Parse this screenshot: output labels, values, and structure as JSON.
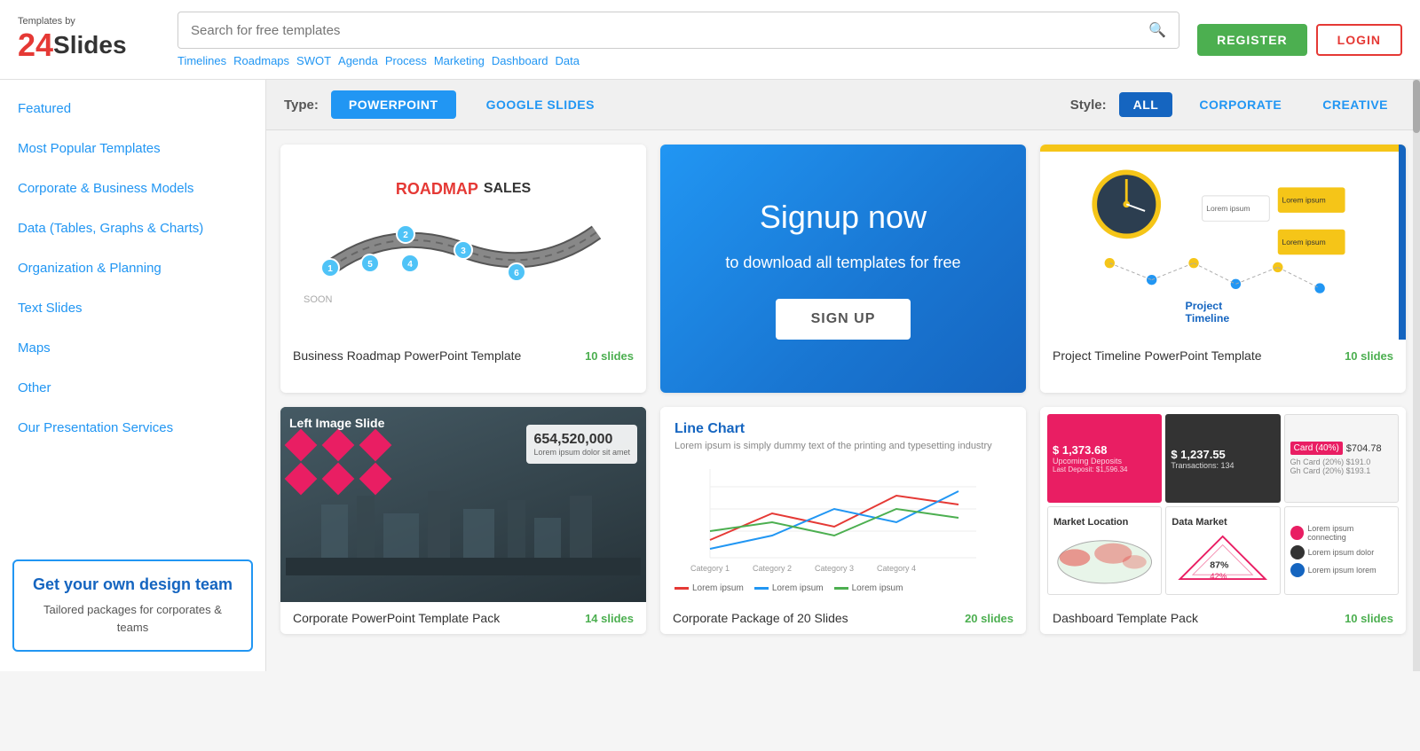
{
  "header": {
    "logo_prefix": "Templates by",
    "logo_brand": "Slides",
    "logo_number": "24",
    "search_placeholder": "Search for free templates",
    "search_tags": [
      "Timelines",
      "Roadmaps",
      "SWOT",
      "Agenda",
      "Process",
      "Marketing",
      "Dashboard",
      "Data"
    ],
    "register_label": "REGISTER",
    "login_label": "LOGIN"
  },
  "filter": {
    "type_label": "Type:",
    "type_options": [
      {
        "label": "POWERPOINT",
        "active": true
      },
      {
        "label": "GOOGLE SLIDES",
        "active": false
      }
    ],
    "style_label": "Style:",
    "style_options": [
      {
        "label": "ALL",
        "active": true
      },
      {
        "label": "CORPORATE",
        "active": false
      },
      {
        "label": "CREATIVE",
        "active": false
      }
    ]
  },
  "sidebar": {
    "nav_items": [
      {
        "label": "Featured",
        "active": false
      },
      {
        "label": "Most Popular Templates",
        "active": false
      },
      {
        "label": "Corporate & Business Models",
        "active": false
      },
      {
        "label": "Data (Tables, Graphs & Charts)",
        "active": false
      },
      {
        "label": "Organization & Planning",
        "active": false
      },
      {
        "label": "Text Slides",
        "active": false
      },
      {
        "label": "Maps",
        "active": false
      },
      {
        "label": "Other",
        "active": false
      },
      {
        "label": "Our Presentation Services",
        "active": false
      }
    ],
    "promo_title": "Get your own design team",
    "promo_desc": "Tailored packages for corporates & teams"
  },
  "cards": [
    {
      "id": "roadmap",
      "title": "Business Roadmap PowerPoint Template",
      "slides": "10 slides",
      "type": "roadmap"
    },
    {
      "id": "signup",
      "type": "signup",
      "title": "Signup now",
      "subtitle": "to download all templates for free",
      "btn_label": "SIGN UP"
    },
    {
      "id": "timeline",
      "title": "Project Timeline PowerPoint Template",
      "slides": "10 slides",
      "type": "timeline"
    },
    {
      "id": "corporate",
      "title": "Corporate PowerPoint Template Pack",
      "slides": "14 slides",
      "type": "corporate"
    },
    {
      "id": "linechart",
      "title": "Corporate Package of 20 Slides",
      "slides": "20 slides",
      "type": "linechart"
    },
    {
      "id": "dashboard",
      "title": "Dashboard Template Pack",
      "slides": "10 slides",
      "type": "dashboard"
    }
  ]
}
